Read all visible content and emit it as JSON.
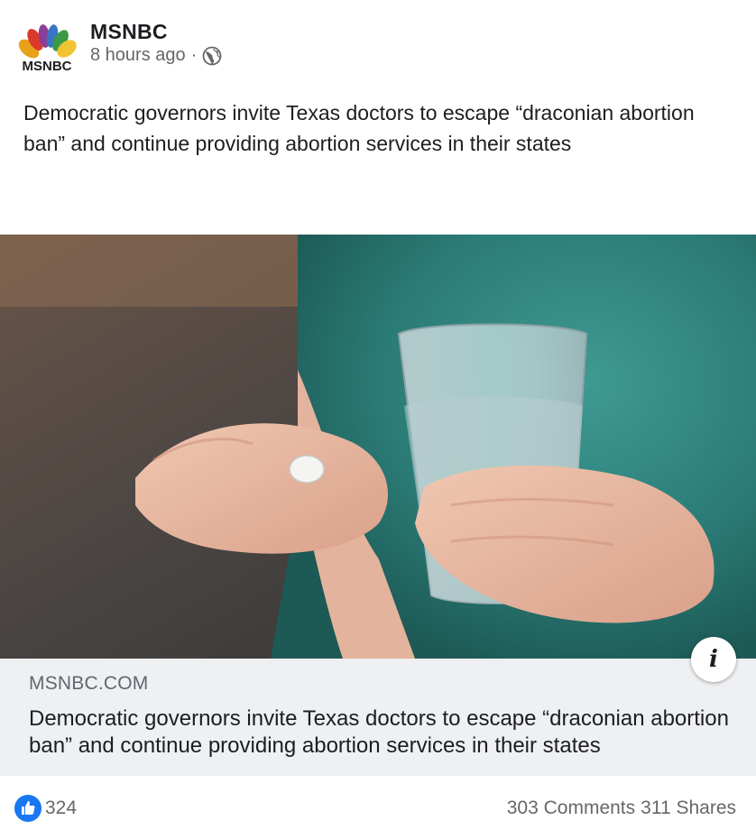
{
  "header": {
    "page_name": "MSNBC",
    "timestamp": "8 hours ago",
    "separator": "·",
    "logo_icon": "msnbc-peacock-icon",
    "audience_icon": "globe-icon"
  },
  "post": {
    "text": "Democratic governors invite Texas doctors to escape “draconian abortion ban” and continue providing abortion services in their states"
  },
  "link_preview": {
    "domain": "MSNBC.COM",
    "title": "Democratic governors invite Texas doctors to escape “draconian abortion ban” and continue providing abortion services in their states",
    "info_icon": "info-icon",
    "info_label": "i"
  },
  "footer": {
    "like_icon": "like-icon",
    "reaction_count": "324",
    "comments": "303 Comments",
    "shares": "311 Shares"
  },
  "colors": {
    "like_blue": "#1877f2",
    "secondary_text": "#65676b",
    "link_box_bg": "#eff0f2"
  }
}
